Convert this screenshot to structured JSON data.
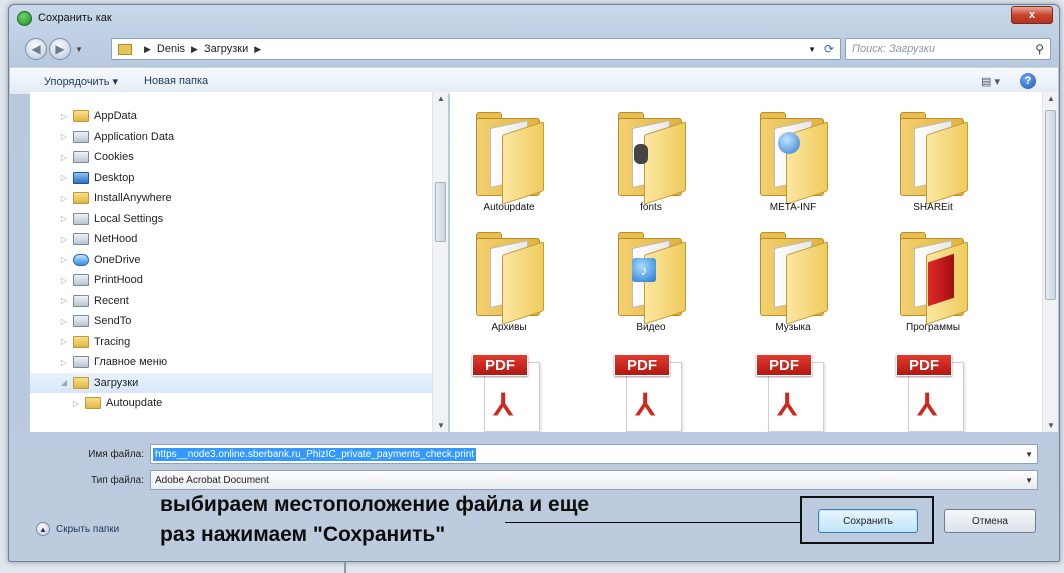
{
  "window": {
    "title": "Сохранить как",
    "close_label": "x"
  },
  "address": {
    "crumbs": [
      "Denis",
      "Загрузки"
    ],
    "search_placeholder": "Поиск: Загрузки"
  },
  "toolbar": {
    "organize": "Упорядочить ▾",
    "new_folder": "Новая папка"
  },
  "tree": {
    "items": [
      {
        "label": "AppData",
        "kind": "folder"
      },
      {
        "label": "Application Data",
        "kind": "locked"
      },
      {
        "label": "Cookies",
        "kind": "locked"
      },
      {
        "label": "Desktop",
        "kind": "desk"
      },
      {
        "label": "InstallAnywhere",
        "kind": "folder"
      },
      {
        "label": "Local Settings",
        "kind": "locked"
      },
      {
        "label": "NetHood",
        "kind": "locked"
      },
      {
        "label": "OneDrive",
        "kind": "cloud"
      },
      {
        "label": "PrintHood",
        "kind": "locked"
      },
      {
        "label": "Recent",
        "kind": "locked"
      },
      {
        "label": "SendTo",
        "kind": "locked"
      },
      {
        "label": "Tracing",
        "kind": "folder"
      },
      {
        "label": "Главное меню",
        "kind": "locked"
      },
      {
        "label": "Загрузки",
        "kind": "folder",
        "selected": true
      },
      {
        "label": "Autoupdate",
        "kind": "folder",
        "child": true
      }
    ]
  },
  "files": {
    "folders": [
      {
        "label": "Autoupdate",
        "emblem": "none"
      },
      {
        "label": "fonts",
        "emblem": "dark"
      },
      {
        "label": "META-INF",
        "emblem": "globe"
      },
      {
        "label": "SHAREit",
        "emblem": "none"
      },
      {
        "label": "Архивы",
        "emblem": "none"
      },
      {
        "label": "Видео",
        "emblem": "music"
      },
      {
        "label": "Музыка",
        "emblem": "none"
      },
      {
        "label": "Программы",
        "emblem": "red"
      }
    ],
    "pdf_badge": "PDF",
    "pdf_logo": "⅄"
  },
  "form": {
    "filename_label": "Имя файла:",
    "filename_value": "https__node3.online.sberbank.ru_PhizIC_private_payments_check.print",
    "filetype_label": "Тип файла:",
    "filetype_value": "Adobe Acrobat Document"
  },
  "footer": {
    "hide_folders": "Скрыть папки",
    "save": "Сохранить",
    "cancel": "Отмена"
  },
  "annotation": {
    "line1": "выбираем местоположение файла и еще",
    "line2": "раз нажимаем \"Сохранить\""
  }
}
